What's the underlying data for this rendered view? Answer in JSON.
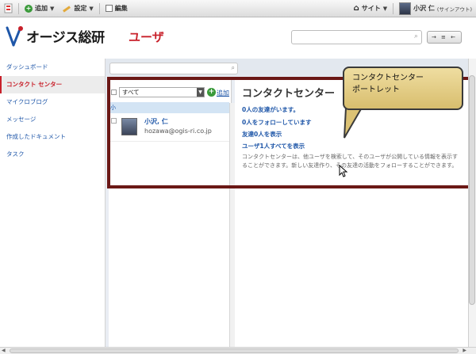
{
  "dock": {
    "add": "追加",
    "manage": "設定",
    "edit": "編集",
    "site": "サイト",
    "user_name": "小沢 仁",
    "signout": "(サインアウト)"
  },
  "header": {
    "logo_text": "オージス総研",
    "page_title": "ユーザ",
    "controls_label": "→ ≡ ←"
  },
  "sidenav": {
    "items": [
      {
        "label": "ダッシュボード"
      },
      {
        "label": "コンタクト センター"
      },
      {
        "label": "マイクロブログ"
      },
      {
        "label": "メッセージ"
      },
      {
        "label": "作成したドキュメント"
      },
      {
        "label": "タスク"
      }
    ]
  },
  "contacts": {
    "filter_value": "すべて",
    "add_label": "追加",
    "group_header": "小",
    "rows": [
      {
        "name": "小沢, 仁",
        "email": "hozawa@ogis-ri.co.jp"
      }
    ]
  },
  "portlet": {
    "title": "コンタクトセンター",
    "friends": "0人の友達がいます。",
    "following": "0人をフォローしています",
    "show_friends": "友達0人を表示",
    "show_users": "ユーザ1人すべてを表示",
    "description": "コンタクトセンターは、他ユーザを検索して、そのユーザが公開している情報を表示することができます。新しい友達作り、その友達の活動をフォローすることができます。"
  },
  "callout": {
    "line1": "コンタクトセンター",
    "line2": "ポートレット"
  },
  "colors": {
    "accent_red": "#c8202a",
    "link_blue": "#1e56a8",
    "frame": "#6b1816",
    "callout_bg": "#e4cc85"
  }
}
